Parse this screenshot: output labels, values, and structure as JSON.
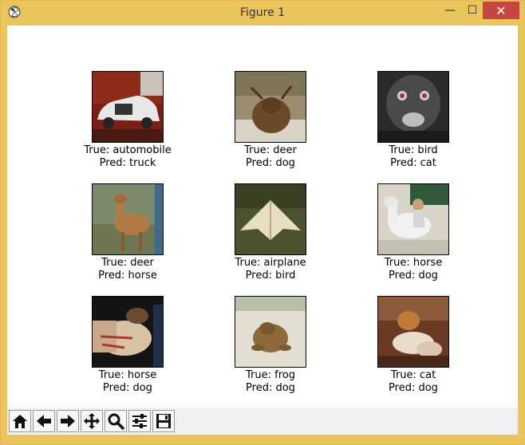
{
  "window": {
    "title": "Figure 1",
    "minimize_glyph": "—",
    "maximize_glyph": "☐",
    "close_glyph": "✕"
  },
  "grid": [
    {
      "true_text": "True: automobile",
      "pred_text": "Pred: truck",
      "image": "automobile"
    },
    {
      "true_text": "True: deer",
      "pred_text": "Pred: dog",
      "image": "deer"
    },
    {
      "true_text": "True: bird",
      "pred_text": "Pred: cat",
      "image": "bird"
    },
    {
      "true_text": "True: deer",
      "pred_text": "Pred: horse",
      "image": "deer"
    },
    {
      "true_text": "True: airplane",
      "pred_text": "Pred: bird",
      "image": "airplane"
    },
    {
      "true_text": "True: horse",
      "pred_text": "Pred: dog",
      "image": "horse"
    },
    {
      "true_text": "True: horse",
      "pred_text": "Pred: dog",
      "image": "horse"
    },
    {
      "true_text": "True: frog",
      "pred_text": "Pred: dog",
      "image": "frog"
    },
    {
      "true_text": "True: cat",
      "pred_text": "Pred: dog",
      "image": "cat"
    }
  ],
  "toolbar": {
    "tools": [
      "home-icon",
      "back-arrow-icon",
      "forward-arrow-icon",
      "pan-icon",
      "zoom-icon",
      "configure-subplots-icon",
      "save-icon"
    ]
  },
  "colors": {
    "frame": "#eac55c",
    "close_button": "#c7463f"
  }
}
